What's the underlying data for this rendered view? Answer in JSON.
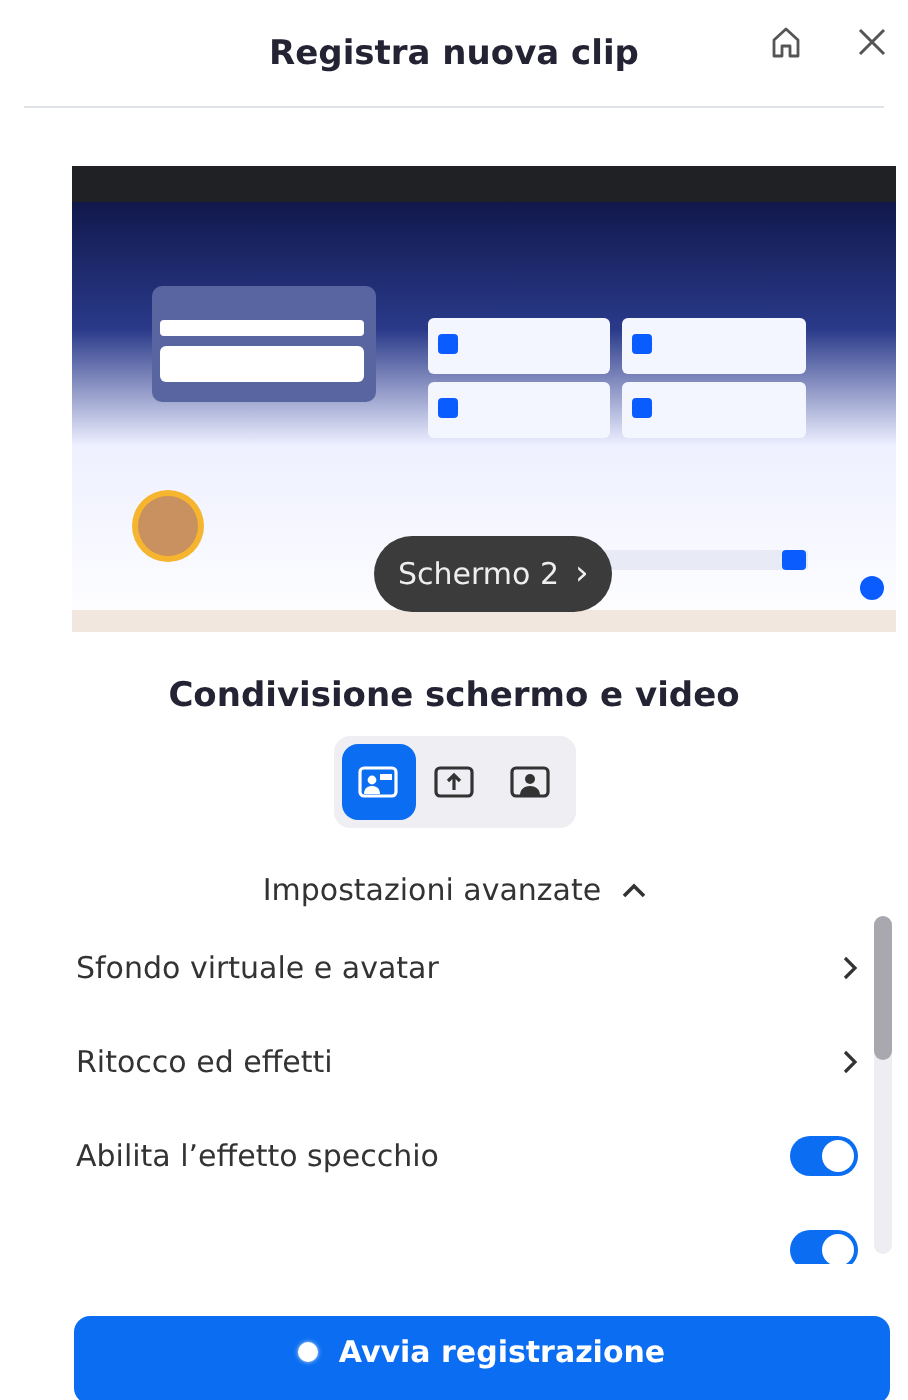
{
  "window": {
    "title": "Registra nuova clip"
  },
  "preview": {
    "screen_label": "Schermo 2",
    "chevron": "›"
  },
  "section_title": "Condivisione schermo e video",
  "modes": [
    {
      "kind": "screen-camera",
      "selected": true
    },
    {
      "kind": "screen",
      "selected": false
    },
    {
      "kind": "camera",
      "selected": false
    }
  ],
  "advanced": {
    "label": "Impostazioni avanzate",
    "expanded": true
  },
  "settings": [
    {
      "kind": "link",
      "label": "Sfondo virtuale e avatar"
    },
    {
      "kind": "link",
      "label": "Ritocco ed effetti"
    },
    {
      "kind": "toggle",
      "label": "Abilita l’effetto specchio",
      "on": true
    },
    {
      "kind": "toggle",
      "on": true
    }
  ],
  "start_button": "Avvia registrazione"
}
